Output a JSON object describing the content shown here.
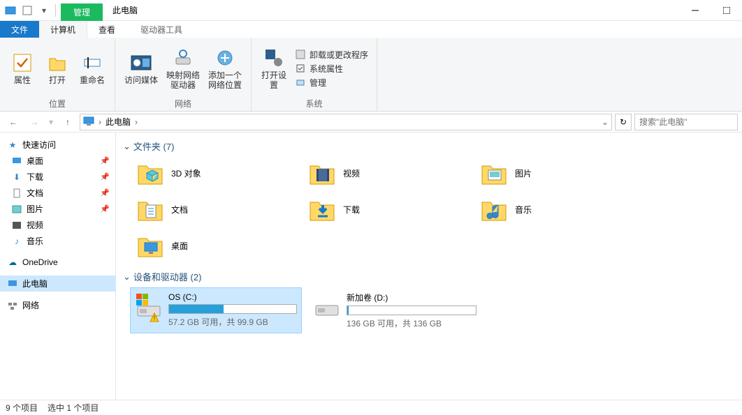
{
  "appTitle": "此电脑",
  "contextTab": "管理",
  "contextSubTab": "驱动器工具",
  "tabs": {
    "file": "文件",
    "computer": "计算机",
    "view": "查看"
  },
  "ribbon": {
    "group1": {
      "title": "位置",
      "btn_props": "属性",
      "btn_open": "打开",
      "btn_rename": "重命名"
    },
    "group2": {
      "title": "网络",
      "btn_media": "访问媒体",
      "btn_map": "映射网络驱动器",
      "btn_addloc": "添加一个网络位置"
    },
    "group3": {
      "title": "系统",
      "btn_opensettings": "打开设置",
      "row_uninstall": "卸载或更改程序",
      "row_sysprops": "系统属性",
      "row_manage": "管理"
    }
  },
  "address": {
    "root": "此电脑"
  },
  "search": {
    "placeholder": "搜索\"此电脑\""
  },
  "sidebar": {
    "quick": "快速访问",
    "desktop": "桌面",
    "downloads": "下载",
    "documents": "文档",
    "pictures": "图片",
    "videos": "视频",
    "music": "音乐",
    "onedrive": "OneDrive",
    "thispc": "此电脑",
    "network": "网络"
  },
  "sections": {
    "folders_title": "文件夹 (7)",
    "folders": [
      {
        "name": "3D 对象",
        "icon": "cube"
      },
      {
        "name": "视频",
        "icon": "film"
      },
      {
        "name": "图片",
        "icon": "picture"
      },
      {
        "name": "文档",
        "icon": "doc"
      },
      {
        "name": "下载",
        "icon": "download"
      },
      {
        "name": "音乐",
        "icon": "music"
      },
      {
        "name": "桌面",
        "icon": "desktop"
      }
    ],
    "drives_title": "设备和驱动器 (2)",
    "drives": [
      {
        "name": "OS (C:)",
        "used_pct": 43,
        "sub": "57.2 GB 可用，共 99.9 GB",
        "warn": true,
        "selected": true
      },
      {
        "name": "新加卷 (D:)",
        "used_pct": 1,
        "sub": "136 GB 可用，共 136 GB",
        "warn": false,
        "selected": false
      }
    ]
  },
  "status": {
    "count": "9 个项目",
    "selected": "选中 1 个项目"
  }
}
